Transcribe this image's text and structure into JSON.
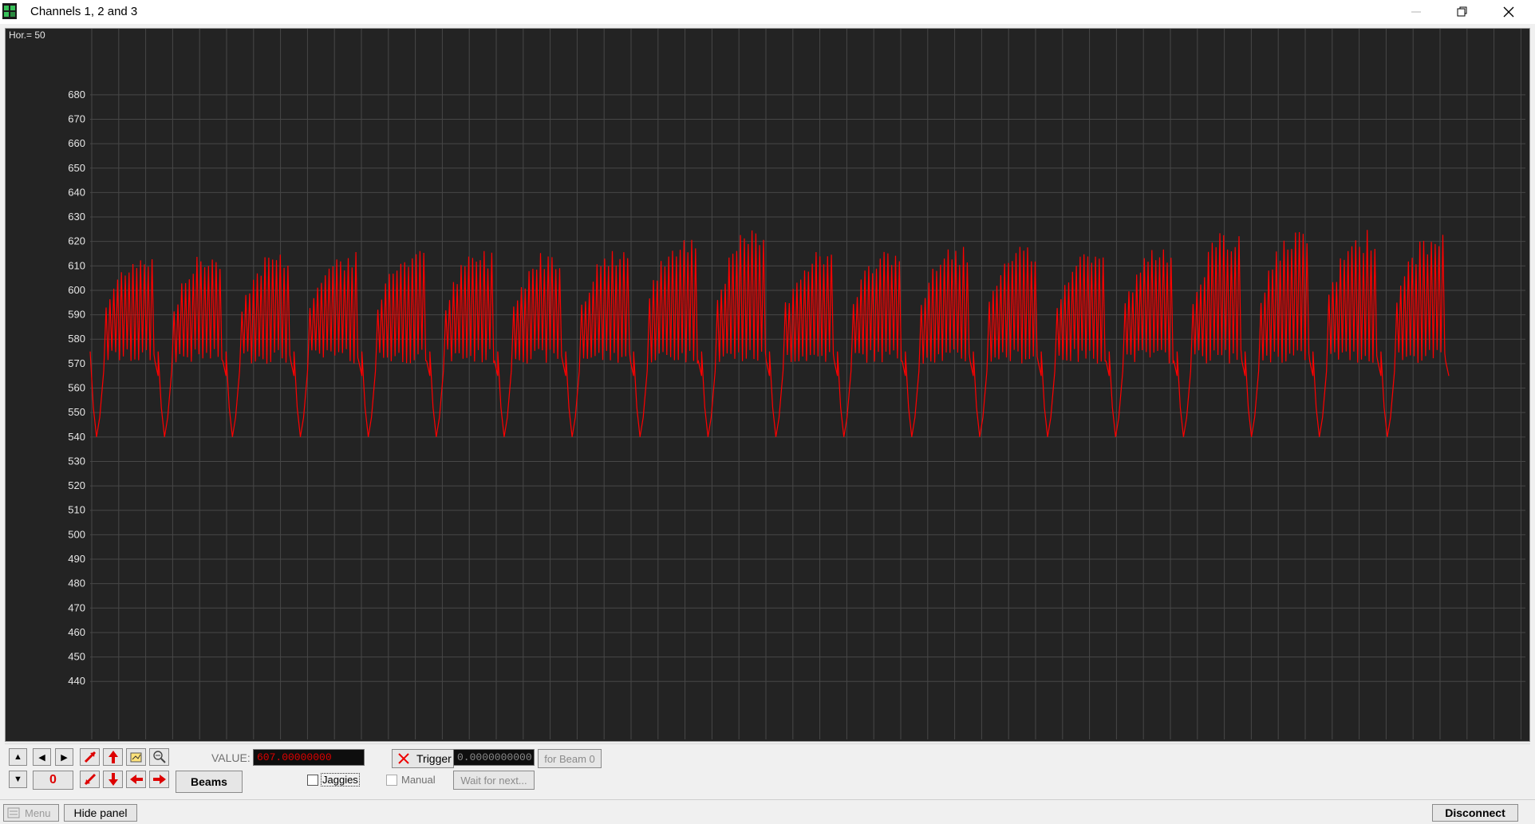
{
  "window": {
    "title": "Channels 1, 2 and 3"
  },
  "plot": {
    "horizontal_label": "Hor.= 50",
    "y_ticks": [
      "680",
      "670",
      "660",
      "650",
      "640",
      "630",
      "620",
      "610",
      "600",
      "590",
      "580",
      "570",
      "560",
      "550",
      "540",
      "530",
      "520",
      "510",
      "500",
      "490",
      "480",
      "470",
      "460",
      "450",
      "440"
    ]
  },
  "chart_data": {
    "type": "line",
    "title": "",
    "xlabel": "",
    "ylabel": "",
    "ylim": [
      428,
      693
    ],
    "grid": true,
    "series": [
      {
        "color": "#ff0000",
        "cycles": 20,
        "baseline": 570,
        "minimum": 540,
        "peaks": [
          616,
          616,
          617,
          616,
          617,
          617,
          617,
          618,
          624,
          625,
          617,
          618,
          619,
          618,
          618,
          618,
          624,
          624,
          625,
          623
        ]
      }
    ]
  },
  "controls": {
    "value_label": "VALUE:",
    "value": "607.00000000",
    "counter": "0",
    "beams_label": "Beams",
    "jaggies_label": "Jaggies",
    "trigger_label": "Trigger",
    "trigger_value": "0.0000000000",
    "for_beam_label": "for Beam 0",
    "manual_label": "Manual",
    "wait_label": "Wait for next..."
  },
  "status": {
    "menu_label": "Menu",
    "hide_panel_label": "Hide panel",
    "disconnect_label": "Disconnect"
  },
  "colors": {
    "trace": "#ff0000",
    "plot_bg": "#232323",
    "grid": "#474747",
    "value_text": "#e00000"
  },
  "icons": [
    "app-icon",
    "minimize-icon",
    "restore-icon",
    "close-icon",
    "up-arrow-icon",
    "left-arrow-icon",
    "right-arrow-icon",
    "down-arrow-icon",
    "auto-scale-icon",
    "zoom-up-icon",
    "zoom-down-icon",
    "fit-icon",
    "zoom-out-icon",
    "shift-left-icon",
    "shift-right-icon",
    "trigger-x-icon",
    "menu-icon"
  ]
}
